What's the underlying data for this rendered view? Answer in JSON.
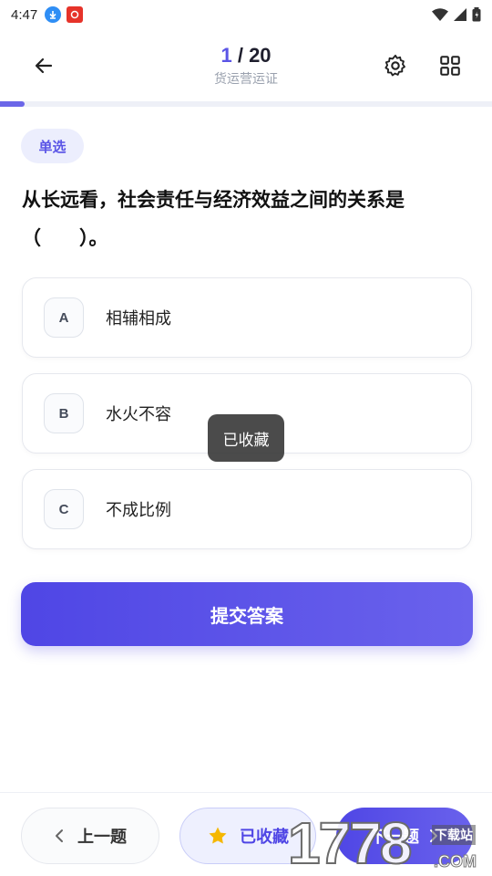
{
  "status_bar": {
    "time": "4:47"
  },
  "header": {
    "current": "1",
    "separator": "/",
    "total": "20",
    "subject": "货运营运证"
  },
  "progress": {
    "fraction": 0.05
  },
  "question": {
    "type_badge": "单选",
    "text": "从长远看，社会责任与经济效益之间的关系是（　　）。"
  },
  "options": [
    {
      "letter": "A",
      "text": "相辅相成"
    },
    {
      "letter": "B",
      "text": "水火不容"
    },
    {
      "letter": "C",
      "text": "不成比例"
    }
  ],
  "toast": {
    "text": "已收藏"
  },
  "submit": {
    "label": "提交答案"
  },
  "bottom": {
    "prev_label": "上一题",
    "fav_label": "已收藏",
    "next_label": "下一题"
  },
  "watermark": {
    "number": "1778",
    "site": "下载站",
    "domain": ".COM"
  },
  "colors": {
    "accent": "#5b55e6",
    "star": "#f5b700"
  },
  "icons": [
    "back-arrow-icon",
    "gear-icon",
    "grid-icon",
    "chevron-left-icon",
    "star-icon",
    "chevron-right-icon"
  ]
}
